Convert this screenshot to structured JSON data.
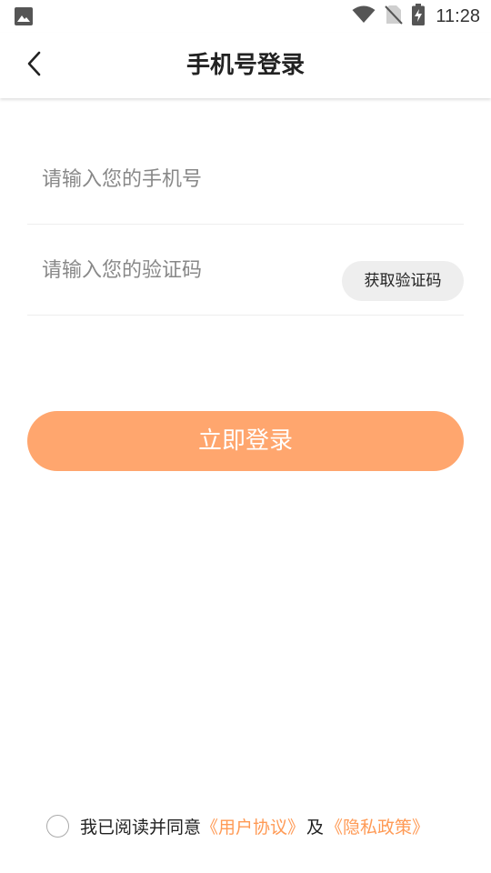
{
  "status_bar": {
    "time": "11:28",
    "left_icon": "image-icon",
    "right_icons": [
      "wifi-icon",
      "no-sim-icon",
      "battery-charging-icon"
    ]
  },
  "header": {
    "title": "手机号登录",
    "back_icon": "chevron-left-icon"
  },
  "form": {
    "phone": {
      "value": "",
      "placeholder": "请输入您的手机号"
    },
    "code": {
      "value": "",
      "placeholder": "请输入您的验证码"
    },
    "get_code_label": "获取验证码",
    "login_label": "立即登录"
  },
  "agreement": {
    "checked": false,
    "prefix": "我已阅读并同意",
    "user_agreement": "《用户协议》",
    "and": "及",
    "privacy_policy": "《隐私政策》"
  },
  "colors": {
    "accent": "#FFA66E",
    "link": "#FF9A55",
    "divider": "#EEEEEE",
    "placeholder": "#888888",
    "code_button_bg": "#EEEEEE"
  }
}
